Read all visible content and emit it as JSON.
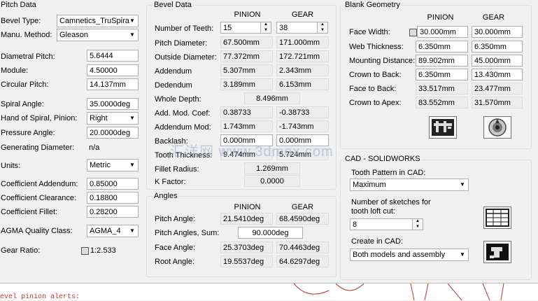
{
  "pitch": {
    "title": "Pitch Data",
    "bevel_type_label": "Bevel Type:",
    "bevel_type_value": "Camnetics_TruSpira",
    "manu_label": "Manu. Method:",
    "manu_value": "Gleason",
    "dp_label": "Diametral Pitch:",
    "dp_value": "5.6444",
    "module_label": "Module:",
    "module_value": "4.50000",
    "cp_label": "Circular Pitch:",
    "cp_value": "14.137mm",
    "spiral_label": "Spiral Angle:",
    "spiral_value": "35.0000deg",
    "hand_label": "Hand of Spiral, Pinion:",
    "hand_value": "Right",
    "pressure_label": "Pressure Angle:",
    "pressure_value": "20.0000deg",
    "gen_label": "Generating Diameter:",
    "gen_value": "n/a",
    "units_label": "Units:",
    "units_value": "Metric",
    "ca_label": "Coefficient Addendum:",
    "ca_value": "0.85000",
    "cc_label": "Coefficient Clearance:",
    "cc_value": "0.18800",
    "cf_label": "Coefficient Fillet:",
    "cf_value": "0.28200",
    "agma_label": "AGMA Quality Class:",
    "agma_value": "AGMA_4",
    "ratio_label": "Gear Ratio:",
    "ratio_value": "1:2.533"
  },
  "bevel": {
    "title": "Bevel Data",
    "col_pinion": "PINION",
    "col_gear": "GEAR",
    "rows": [
      {
        "label": "Number of Teeth:",
        "pinion": "15",
        "gear": "38"
      },
      {
        "label": "Pitch Diameter:",
        "pinion": "67.500mm",
        "gear": "171.000mm"
      },
      {
        "label": "Outside Diameter:",
        "pinion": "77.372mm",
        "gear": "172.721mm"
      },
      {
        "label": "Addendum",
        "pinion": "5.307mm",
        "gear": "2.343mm"
      },
      {
        "label": "Dedendum",
        "pinion": "3.189mm",
        "gear": "6.153mm"
      }
    ],
    "whole_depth_label": "Whole Depth:",
    "whole_depth_value": "8.496mm",
    "rows2": [
      {
        "label": "Add. Mod. Coef:",
        "pinion": "0.38733",
        "gear": "-0.38733"
      },
      {
        "label": "Addendum Mod:",
        "pinion": "1.743mm",
        "gear": "-1.743mm"
      },
      {
        "label": "Backlash:",
        "pinion": "0.000mm",
        "gear": "0.000mm"
      },
      {
        "label": "Tooth Thickness:",
        "pinion": "9.474mm",
        "gear": "5.724mm"
      }
    ],
    "fillet_label": "Fillet Radius:",
    "fillet_value": "1.269mm",
    "kfactor_label": "K Factor:",
    "kfactor_value": "0.0000"
  },
  "angles": {
    "title": "Angles",
    "col_pinion": "PINION",
    "col_gear": "GEAR",
    "pitch_label": "Pitch Angle:",
    "pitch_pinion": "21.5410deg",
    "pitch_gear": "68.4590deg",
    "sum_label": "Pitch Angles, Sum:",
    "sum_value": "90.000deg",
    "face_label": "Face Angle:",
    "face_pinion": "25.3703deg",
    "face_gear": "70.4463deg",
    "root_label": "Root Angle:",
    "root_pinion": "19.5537deg",
    "root_gear": "64.6297deg"
  },
  "blank": {
    "title": "Blank Geometry",
    "col_pinion": "PINION",
    "col_gear": "GEAR",
    "rows": [
      {
        "label": "Face Width:",
        "pinion": "30.000mm",
        "gear": "30.000mm"
      },
      {
        "label": "Web Thickness:",
        "pinion": "6.350mm",
        "gear": "6.350mm"
      },
      {
        "label": "Mounting Distance:",
        "pinion": "89.902mm",
        "gear": "45.000mm"
      },
      {
        "label": "Crown to Back:",
        "pinion": "6.350mm",
        "gear": "13.430mm"
      },
      {
        "label": "Face to Back:",
        "pinion": "33.517mm",
        "gear": "23.477mm"
      },
      {
        "label": "Crown to Apex:",
        "pinion": "83.552mm",
        "gear": "31.570mm"
      }
    ]
  },
  "cad": {
    "title": "CAD - SOLIDWORKS",
    "tooth_label": "Tooth Pattern in CAD:",
    "tooth_value": "Maximum",
    "sketch_label1": "Number of sketches for",
    "sketch_label2": "tooth loft cut:",
    "sketch_value": "8",
    "create_label": "Create in CAD:",
    "create_value": "Both models and assembly"
  },
  "watermark": "汇洋网 www.3dmox.com",
  "alerts_text": "evel pinion alerts:",
  "icons": {
    "calipers": "calipers-icon",
    "gear_view": "gear-view-icon",
    "table": "table-icon",
    "create": "create-assembly-icon",
    "dropdown": "chevron-down-icon"
  }
}
